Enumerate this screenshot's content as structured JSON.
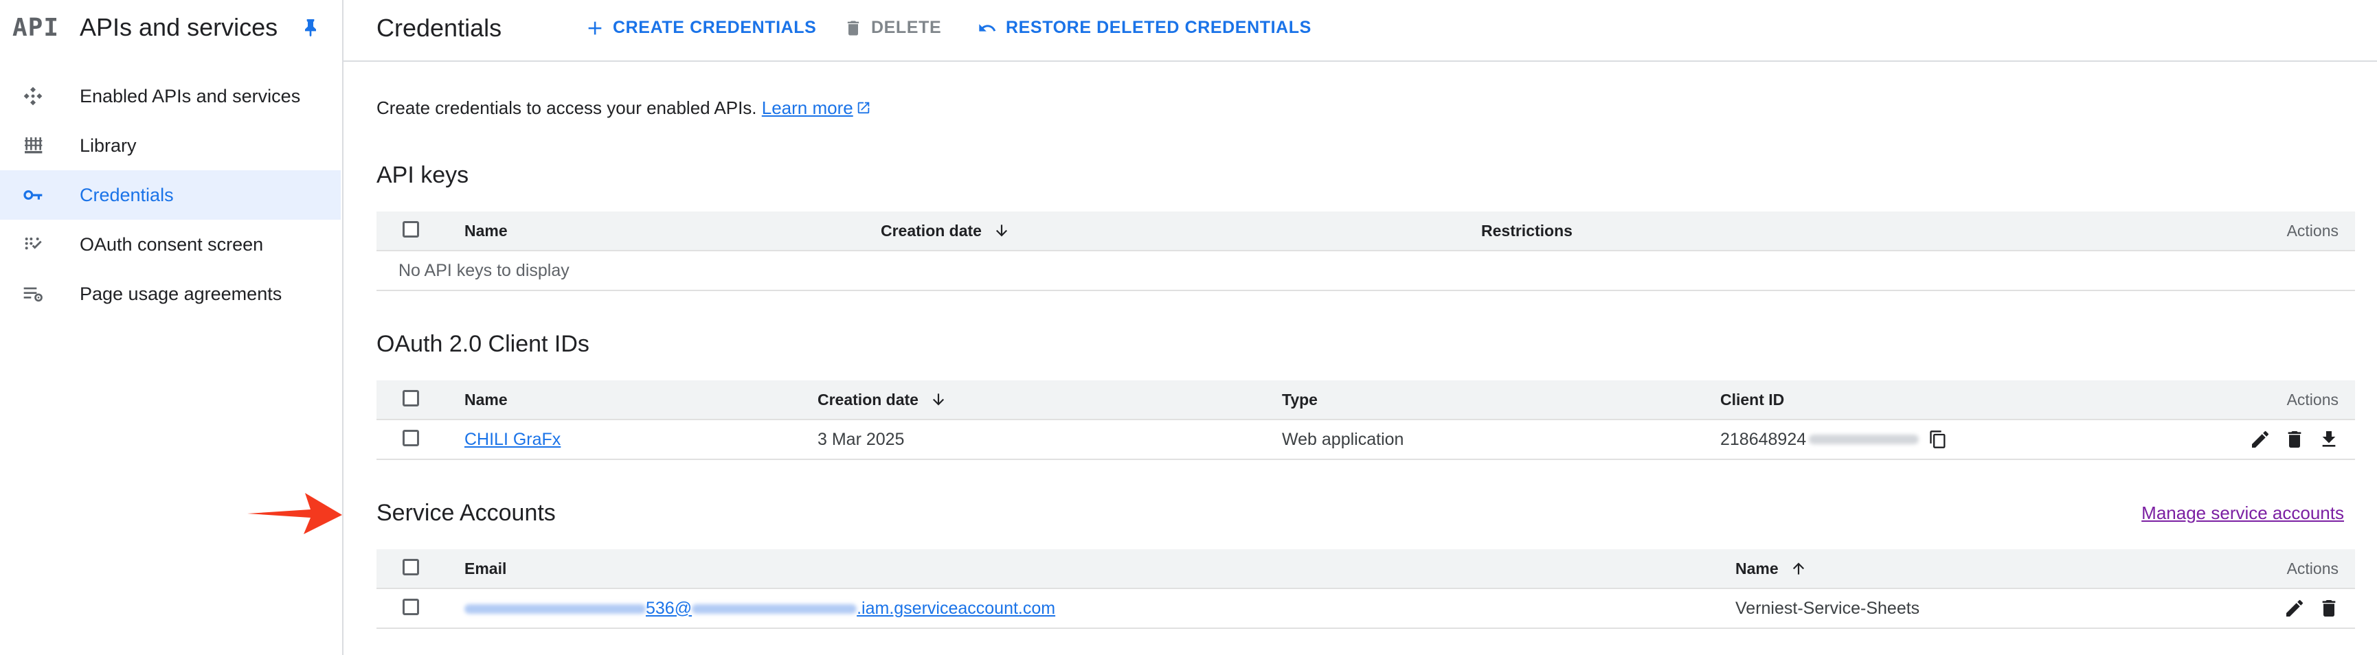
{
  "sidebar": {
    "logo": "API",
    "title": "APIs and services",
    "items": [
      {
        "label": "Enabled APIs and services",
        "icon": "api-hub-icon"
      },
      {
        "label": "Library",
        "icon": "library-icon"
      },
      {
        "label": "Credentials",
        "icon": "key-icon"
      },
      {
        "label": "OAuth consent screen",
        "icon": "consent-icon"
      },
      {
        "label": "Page usage agreements",
        "icon": "settings-list-icon"
      }
    ],
    "active_item": "Credentials"
  },
  "header": {
    "title": "Credentials",
    "actions": {
      "create": "CREATE CREDENTIALS",
      "delete": "DELETE",
      "restore": "RESTORE DELETED CREDENTIALS"
    }
  },
  "intro": {
    "text": "Create credentials to access your enabled APIs.",
    "link": "Learn more"
  },
  "api_keys": {
    "title": "API keys",
    "columns": [
      "Name",
      "Creation date",
      "Restrictions",
      "Actions"
    ],
    "empty_text": "No API keys to display"
  },
  "oauth": {
    "title": "OAuth 2.0 Client IDs",
    "columns": [
      "Name",
      "Creation date",
      "Type",
      "Client ID",
      "Actions"
    ],
    "rows": [
      {
        "name": "CHILI GraFx",
        "date": "3 Mar 2025",
        "type": "Web application",
        "client_id_visible": "218648924"
      }
    ]
  },
  "service_accounts": {
    "title": "Service Accounts",
    "manage_link": "Manage service accounts",
    "columns": [
      "Email",
      "Name",
      "Actions"
    ],
    "rows": [
      {
        "email_fragment_1": "536@",
        "email_suffix": ".iam.gserviceaccount.com",
        "name": "Verniest-Service-Sheets"
      }
    ]
  },
  "colors": {
    "accent": "#1a73e8",
    "active_bg": "#e8f0fe",
    "annotation_arrow": "#f4391e",
    "manage_link": "#7b1fa2"
  }
}
